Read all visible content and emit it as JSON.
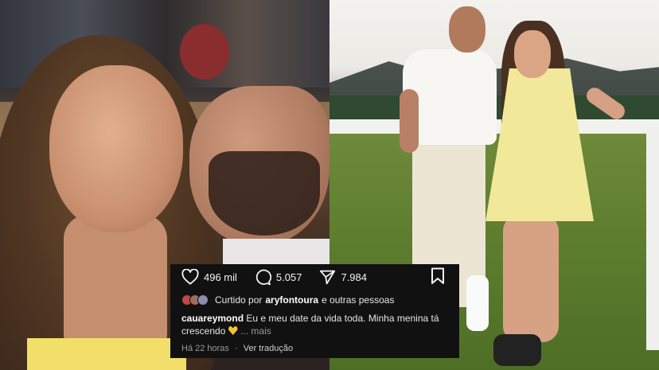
{
  "post": {
    "likes": "496 mil",
    "comments": "5.057",
    "shares": "7.984",
    "liked_prefix": "Curtido por",
    "liked_user": "aryfontoura",
    "liked_suffix": "e outras pessoas",
    "username": "cauareymond",
    "caption_line1": "Eu e meu date da vida toda. Minha menina tá",
    "caption_line2": "crescendo",
    "caption_more": "... mais",
    "time": "Há 22 horas",
    "separator": "·",
    "translate": "Ver tradução"
  },
  "icons": {
    "like": "heart-outline-icon",
    "comment": "comment-bubble-icon",
    "share": "paper-plane-icon",
    "save": "bookmark-icon",
    "caption_emoji": "yellow-heart-icon"
  },
  "colors": {
    "card_background": "#111111",
    "text_primary": "#ffffff",
    "text_secondary": "#9a9a9a",
    "emoji_heart": "#f4c430"
  }
}
